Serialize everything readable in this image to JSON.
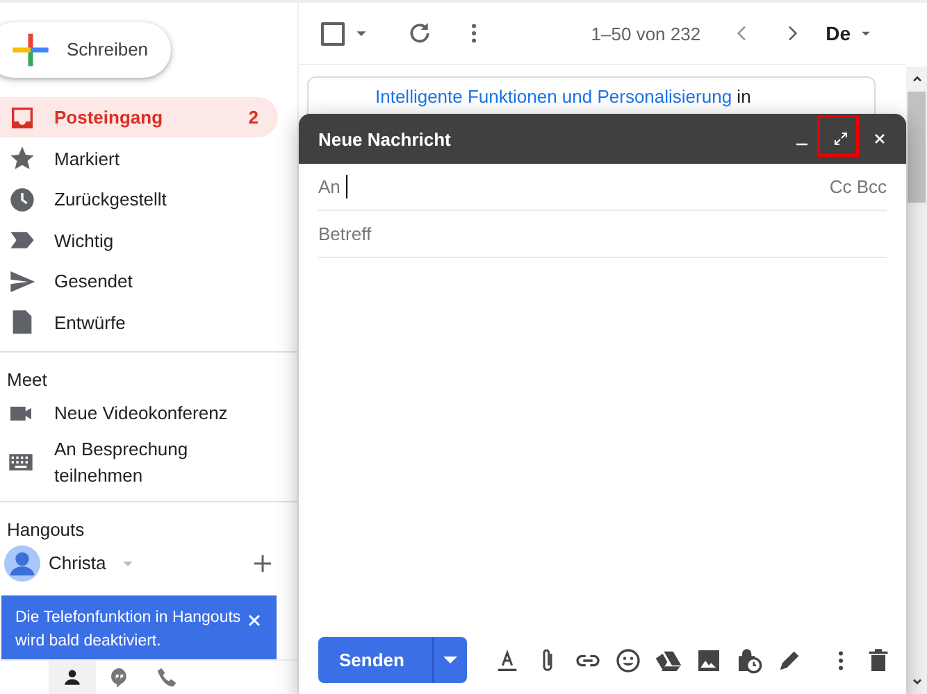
{
  "compose_button": {
    "label": "Schreiben"
  },
  "nav": {
    "items": [
      {
        "label": "Posteingang",
        "count": "2",
        "selected": true
      },
      {
        "label": "Markiert",
        "selected": false
      },
      {
        "label": "Zurückgestellt",
        "selected": false
      },
      {
        "label": "Wichtig",
        "selected": false
      },
      {
        "label": "Gesendet",
        "selected": false
      },
      {
        "label": "Entwürfe",
        "selected": false
      }
    ]
  },
  "meet": {
    "title": "Meet",
    "items": [
      {
        "label": "Neue Videokonferenz"
      },
      {
        "label": "An Besprechung teilnehmen"
      }
    ]
  },
  "hangouts": {
    "title": "Hangouts",
    "user": "Christa",
    "notice": "Die Telefonfunktion in Hangouts wird bald deaktiviert.",
    "tabs": [
      {
        "selected": true
      },
      {
        "selected": false
      },
      {
        "selected": false
      }
    ]
  },
  "toolbar": {
    "checked": false,
    "pagination": "1–50 von 232",
    "input_tool": "De"
  },
  "banner": {
    "link": "Intelligente Funktionen und Personalisierung",
    "text": "in"
  },
  "compose": {
    "title": "Neue Nachricht",
    "controls": [
      {
        "highlighted": false
      },
      {
        "highlighted": true
      },
      {
        "highlighted": false
      }
    ],
    "to_label": "An",
    "cc_bcc": "Cc Bcc",
    "subject_placeholder": "Betreff",
    "send": "Senden"
  }
}
